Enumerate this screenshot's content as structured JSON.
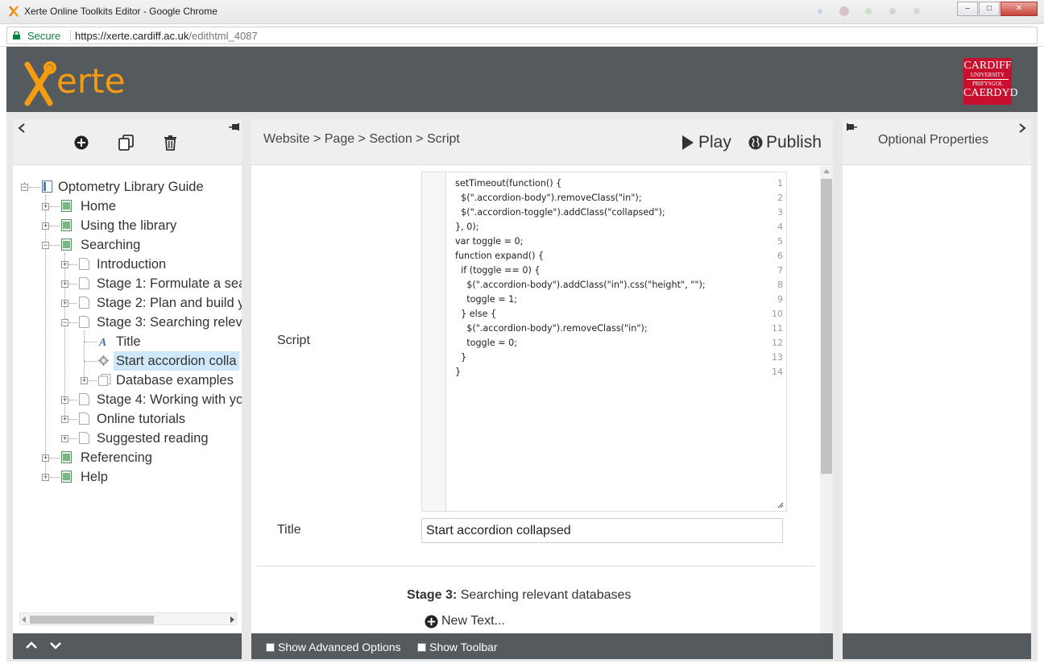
{
  "window": {
    "title": "Xerte Online Toolkits Editor - Google Chrome",
    "minimize": "‒",
    "maximize": "□",
    "close": "✕"
  },
  "address": {
    "secure_label": "Secure",
    "url_host": "https://xerte.cardiff.ac.uk",
    "url_path": "/edithtml_4087"
  },
  "header": {
    "logo_text": "erte",
    "university_logo": {
      "line1": "CARDIFF",
      "line2": "UNIVERSITY",
      "line3": "PRIFYSGOL",
      "line4": "CAERDYD"
    },
    "colors": {
      "header_bg": "#555a5e",
      "logo_accent": "#f39c12",
      "uni_red": "#c8102e"
    }
  },
  "left_panel": {
    "toolbar_icons": [
      "add-icon",
      "duplicate-icon",
      "delete-icon"
    ],
    "tree": [
      {
        "label": "Optometry Library Guide",
        "level": 0,
        "icon": "book-icon",
        "expander": "−"
      },
      {
        "label": "Home",
        "level": 1,
        "icon": "page-green-icon",
        "expander": "+"
      },
      {
        "label": "Using the library",
        "level": 1,
        "icon": "page-green-icon",
        "expander": "+"
      },
      {
        "label": "Searching",
        "level": 1,
        "icon": "page-green-icon",
        "expander": "−"
      },
      {
        "label": "Introduction",
        "level": 2,
        "icon": "page-blank-icon",
        "expander": "+"
      },
      {
        "label": "Stage 1: Formulate a sea",
        "level": 2,
        "icon": "page-blank-icon",
        "expander": "+"
      },
      {
        "label": "Stage 2: Plan and build y",
        "level": 2,
        "icon": "page-blank-icon",
        "expander": "+"
      },
      {
        "label": "Stage 3: Searching relev",
        "level": 2,
        "icon": "page-blank-icon",
        "expander": "−"
      },
      {
        "label": "Title",
        "level": 3,
        "icon": "text-icon",
        "expander": ""
      },
      {
        "label": "Start accordion colla",
        "level": 3,
        "icon": "gear-icon",
        "expander": "",
        "selected": true
      },
      {
        "label": "Database examples",
        "level": 3,
        "icon": "pages-icon",
        "expander": "+"
      },
      {
        "label": "Stage 4: Working with yo",
        "level": 2,
        "icon": "page-blank-icon",
        "expander": "+"
      },
      {
        "label": "Online tutorials",
        "level": 2,
        "icon": "page-blank-icon",
        "expander": "+"
      },
      {
        "label": "Suggested reading",
        "level": 2,
        "icon": "page-blank-icon",
        "expander": "+"
      },
      {
        "label": "Referencing",
        "level": 1,
        "icon": "page-green-icon",
        "expander": "+"
      },
      {
        "label": "Help",
        "level": 1,
        "icon": "page-green-icon",
        "expander": "+"
      }
    ]
  },
  "center": {
    "breadcrumb": "Website > Page > Section > Script",
    "play_label": "Play",
    "publish_label": "Publish",
    "script_label": "Script",
    "code_lines": [
      "setTimeout(function() {",
      "  $(\".accordion-body\").removeClass(\"in\");",
      "  $(\".accordion-toggle\").addClass(\"collapsed\");",
      "}, 0);",
      "var toggle = 0;",
      "function expand() {",
      "  if (toggle == 0) {",
      "    $(\".accordion-body\").addClass(\"in\").css(\"height\", \"\");",
      "    toggle = 1;",
      "  } else {",
      "    $(\".accordion-body\").removeClass(\"in\");",
      "    toggle = 0;",
      "  }",
      "}"
    ],
    "title_label": "Title",
    "title_value": "Start accordion collapsed",
    "stage_heading_bold": "Stage 3:",
    "stage_heading_rest": " Searching relevant databases",
    "new_text_label": "New Text...",
    "show_advanced_label": "Show Advanced Options",
    "show_toolbar_label": "Show Toolbar"
  },
  "right_panel": {
    "title": "Optional Properties"
  }
}
